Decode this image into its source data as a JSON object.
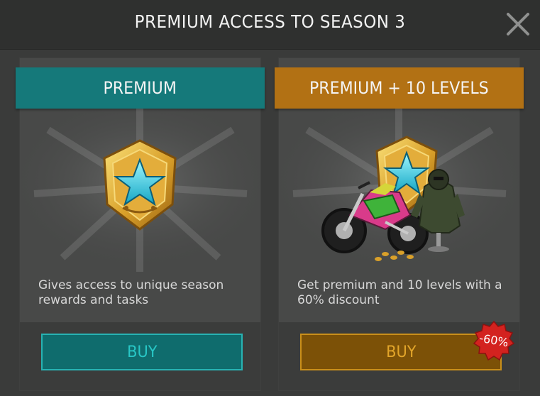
{
  "header": {
    "title": "PREMIUM ACCESS TO SEASON 3",
    "close_icon": "close-icon"
  },
  "cards": [
    {
      "ribbon": "PREMIUM",
      "description": "Gives access to unique season rewards and tasks",
      "buy_label": "BUY",
      "accent": "#15797a",
      "art_icon": "premium-badge-icon"
    },
    {
      "ribbon": "PREMIUM + 10 LEVELS",
      "description": "Get premium and 10 levels with a 60% discount",
      "buy_label": "BUY",
      "accent": "#b27114",
      "art_icon": "premium-bundle-icon",
      "discount_badge": "-60%"
    }
  ]
}
